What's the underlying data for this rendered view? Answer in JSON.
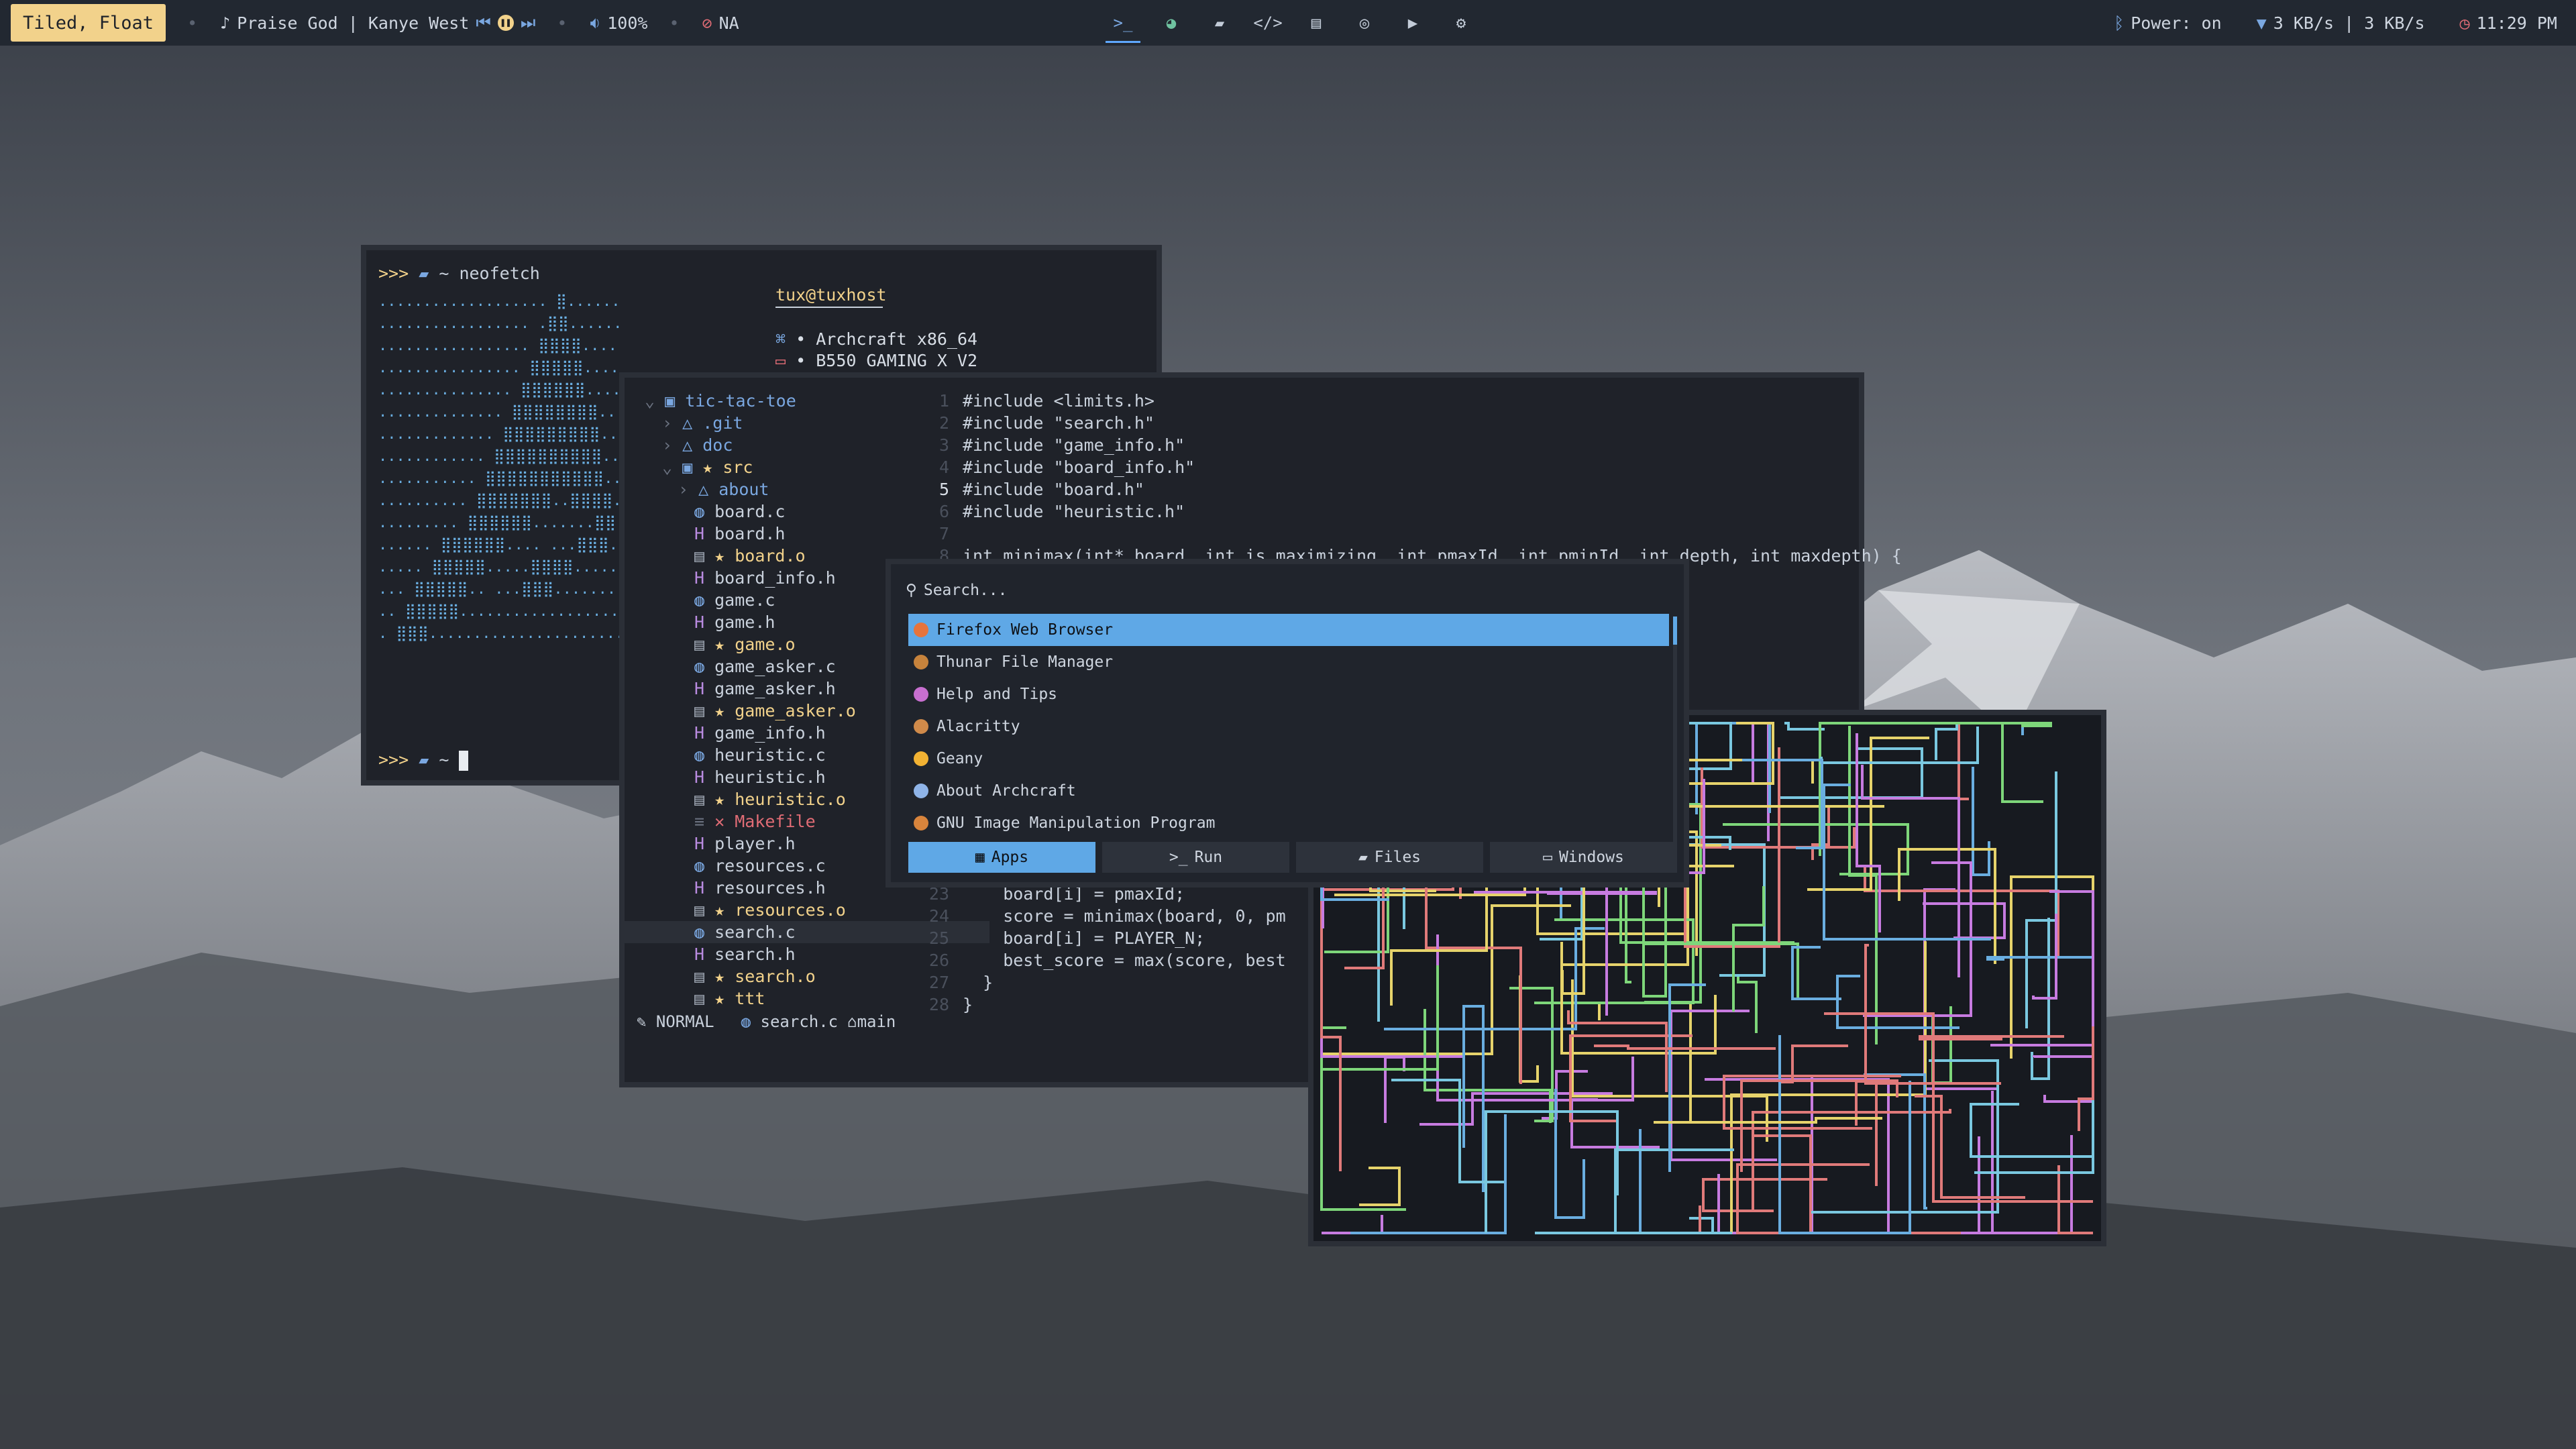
{
  "topbar": {
    "mode": "Tiled, Float",
    "music": "Praise God | Kanye West",
    "volume": "100%",
    "battery": "NA",
    "bluetooth": "Power: on",
    "network": "3 KB/s | 3 KB/s",
    "clock": "11:29 PM",
    "dot": "•"
  },
  "terminal": {
    "prompt_arrows": ">>>",
    "cwd": "~",
    "command": "neofetch",
    "user_host": "tux@tuxhost",
    "os": "Archcraft x86_64",
    "host": "B550 GAMING X V2",
    "bullet": "•"
  },
  "editor": {
    "tree": [
      {
        "label": "tic-tac-toe",
        "icon": "folder-git-icon",
        "color": "#7aa7e0"
      },
      {
        "label": ".git",
        "icon": "git-icon",
        "color": "#7aa7e0"
      },
      {
        "label": "doc",
        "icon": "folder-icon",
        "color": "#7aa7e0"
      },
      {
        "label": "★ src",
        "icon": "folder-open-icon",
        "color": "#f2d28b"
      },
      {
        "label": "about",
        "icon": "folder-icon",
        "color": "#7aa7e0"
      },
      {
        "label": "board.c",
        "icon": "c-file-icon",
        "color": "#c9d1dc"
      },
      {
        "label": "board.h",
        "icon": "h-file-icon",
        "color": "#c9d1dc"
      },
      {
        "label": "★ board.o",
        "icon": "object-file-icon",
        "color": "#f2d28b"
      },
      {
        "label": "board_info.h",
        "icon": "h-file-icon",
        "color": "#c9d1dc"
      },
      {
        "label": "game.c",
        "icon": "c-file-icon",
        "color": "#c9d1dc"
      },
      {
        "label": "game.h",
        "icon": "h-file-icon",
        "color": "#c9d1dc"
      },
      {
        "label": "★ game.o",
        "icon": "object-file-icon",
        "color": "#f2d28b"
      },
      {
        "label": "game_asker.c",
        "icon": "c-file-icon",
        "color": "#c9d1dc"
      },
      {
        "label": "game_asker.h",
        "icon": "h-file-icon",
        "color": "#c9d1dc"
      },
      {
        "label": "★ game_asker.o",
        "icon": "object-file-icon",
        "color": "#f2d28b"
      },
      {
        "label": "game_info.h",
        "icon": "h-file-icon",
        "color": "#c9d1dc"
      },
      {
        "label": "heuristic.c",
        "icon": "c-file-icon",
        "color": "#c9d1dc"
      },
      {
        "label": "heuristic.h",
        "icon": "h-file-icon",
        "color": "#c9d1dc"
      },
      {
        "label": "★ heuristic.o",
        "icon": "object-file-icon",
        "color": "#f2d28b"
      },
      {
        "label": "✕ Makefile",
        "icon": "makefile-icon",
        "color": "#e06c75"
      },
      {
        "label": "player.h",
        "icon": "h-file-icon",
        "color": "#c9d1dc"
      },
      {
        "label": "resources.c",
        "icon": "c-file-icon",
        "color": "#c9d1dc"
      },
      {
        "label": "resources.h",
        "icon": "h-file-icon",
        "color": "#c9d1dc"
      },
      {
        "label": "★ resources.o",
        "icon": "object-file-icon",
        "color": "#f2d28b"
      },
      {
        "label": "search.c",
        "icon": "c-file-icon",
        "color": "#c9d1dc"
      },
      {
        "label": "search.h",
        "icon": "h-file-icon",
        "color": "#c9d1dc"
      },
      {
        "label": "★ search.o",
        "icon": "object-file-icon",
        "color": "#f2d28b"
      },
      {
        "label": "★ ttt",
        "icon": "object-file-icon",
        "color": "#f2d28b"
      }
    ],
    "code_top": [
      {
        "n": "1",
        "text": "#include <limits.h>"
      },
      {
        "n": "2",
        "text": "#include \"search.h\""
      },
      {
        "n": "3",
        "text": "#include \"game_info.h\""
      },
      {
        "n": "4",
        "text": "#include \"board_info.h\""
      },
      {
        "n": "5",
        "text": "#include \"board.h\""
      },
      {
        "n": "6",
        "text": "#include \"heuristic.h\""
      },
      {
        "n": "7",
        "text": ""
      },
      {
        "n": "8",
        "text": "int minimax(int* board, int is_maximizing, int pmaxId, int pminId, int depth, int maxdepth) {"
      }
    ],
    "code_bottom": [
      {
        "n": "23",
        "text": "    board[i] = pmaxId;"
      },
      {
        "n": "24",
        "text": "    score = minimax(board, 0, pm"
      },
      {
        "n": "25",
        "text": "    board[i] = PLAYER_N;"
      },
      {
        "n": "26",
        "text": "    best_score = max(score, best"
      },
      {
        "n": "27",
        "text": "  }"
      },
      {
        "n": "28",
        "text": "}"
      }
    ],
    "status": {
      "mode": "NORMAL",
      "file": "search.c",
      "branch": "main"
    }
  },
  "launcher": {
    "search_placeholder": "Search...",
    "items": [
      {
        "label": "Firefox Web Browser",
        "icon": "firefox-icon",
        "color": "#e8743b"
      },
      {
        "label": "Thunar File Manager",
        "icon": "thunar-icon",
        "color": "#c7833c"
      },
      {
        "label": "Help and Tips",
        "icon": "archcraft-icon",
        "color": "#c86fd0"
      },
      {
        "label": "Alacritty",
        "icon": "alacritty-icon",
        "color": "#d08a4a"
      },
      {
        "label": "Geany",
        "icon": "geany-icon",
        "color": "#f2b233"
      },
      {
        "label": "About Archcraft",
        "icon": "archcraft-icon",
        "color": "#8fb4e8"
      },
      {
        "label": "GNU Image Manipulation Program",
        "icon": "gimp-icon",
        "color": "#d8843c"
      }
    ],
    "modes": [
      {
        "label": "Apps",
        "icon": "grid-icon"
      },
      {
        "label": "Run",
        "icon": "terminal-icon"
      },
      {
        "label": "Files",
        "icon": "folder-icon"
      },
      {
        "label": "Windows",
        "icon": "window-icon"
      }
    ]
  },
  "colors": {
    "accent": "#5fa8e6",
    "badge": "#f2d28b",
    "bar_bg": "#222831"
  }
}
